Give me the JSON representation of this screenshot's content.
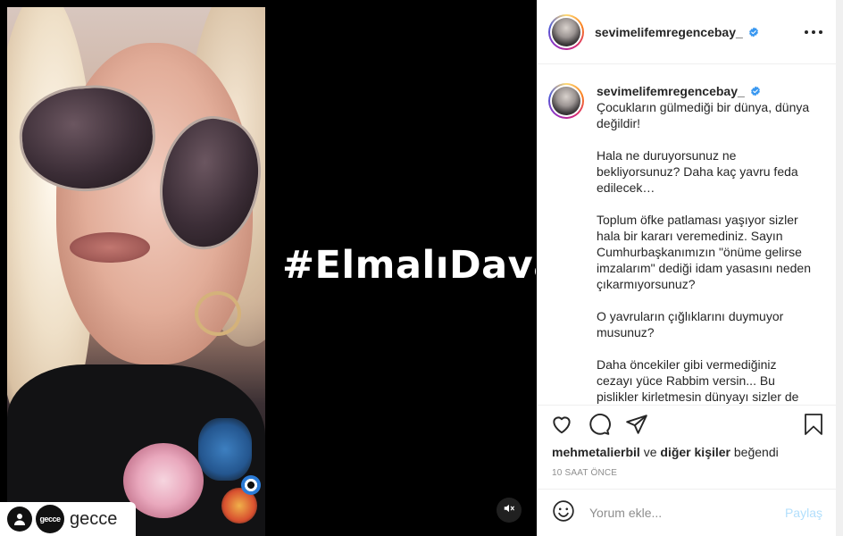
{
  "media": {
    "hashtag": "#ElmalıDavası",
    "watermark_brand": "gecce",
    "watermark_logo": "gecce",
    "mute_icon": "speaker-muted-icon"
  },
  "post": {
    "username": "sevimelifemregencebay_",
    "caption": {
      "username": "sevimelifemregencebay_",
      "paragraphs": [
        "Çocukların gülmediği bir dünya, dünya değildir!",
        "Hala ne duruyorsunuz ne bekliyorsunuz? Daha kaç yavru feda edilecek…",
        "Toplum öfke patlaması yaşıyor sizler hala bir kararı veremediniz. Sayın Cumhurbaşkanımızın \"önüme gelirse imzalarım\" dediği idam yasasını neden çıkarmıyorsunuz?",
        "O yavruların çığlıklarını duymuyor musunuz?",
        "Daha öncekiler gibi vermediğiniz cezayı yüce Rabbim versin... Bu pislikler kirletmesin dünyayı sizler de"
      ]
    },
    "likes": {
      "user": "mehmetalierbil",
      "connector": "ve",
      "others": "diğer kişiler",
      "suffix": "beğendi"
    },
    "time": "10 SAAT ÖNCE",
    "comment": {
      "placeholder": "Yorum ekle...",
      "post_label": "Paylaş"
    }
  },
  "colors": {
    "verified": "#3897f0",
    "post_button_disabled": "#b2dffc",
    "muted_text": "#8e8e8e"
  }
}
